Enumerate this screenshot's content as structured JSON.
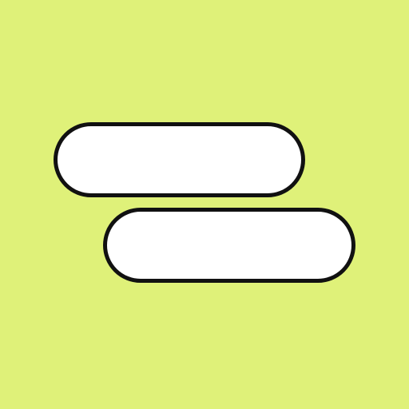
{
  "colors": {
    "background": "#dff179",
    "pill_fill": "#ffffff",
    "pill_outline": "#111111"
  },
  "shapes": [
    {
      "name": "pill-top"
    },
    {
      "name": "pill-bottom"
    }
  ]
}
